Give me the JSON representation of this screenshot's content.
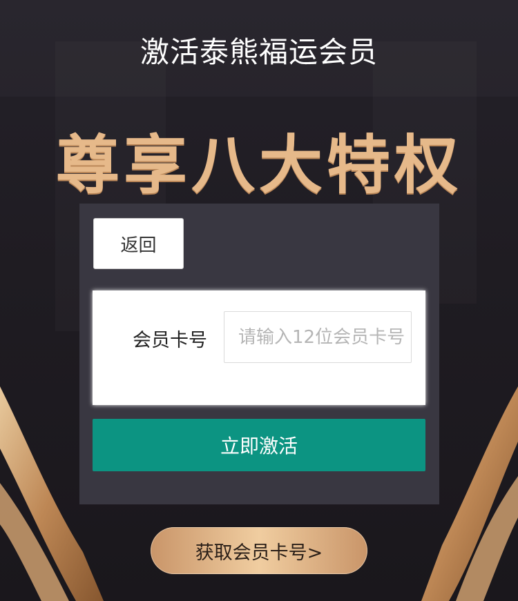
{
  "header": {
    "title": "激活泰熊福运会员"
  },
  "hero": {
    "title": "尊享八大特权"
  },
  "panel": {
    "back_label": "返回",
    "field_label": "会员卡号",
    "card_input": {
      "placeholder": "请输入12位会员卡号",
      "value": ""
    },
    "activate_label": "立即激活"
  },
  "footer": {
    "get_card_label": "获取会员卡号>"
  },
  "colors": {
    "accent_gold": "#e6b98a",
    "activate_green": "#0c9482",
    "panel_bg": "#393741",
    "page_bg": "#201d23"
  }
}
